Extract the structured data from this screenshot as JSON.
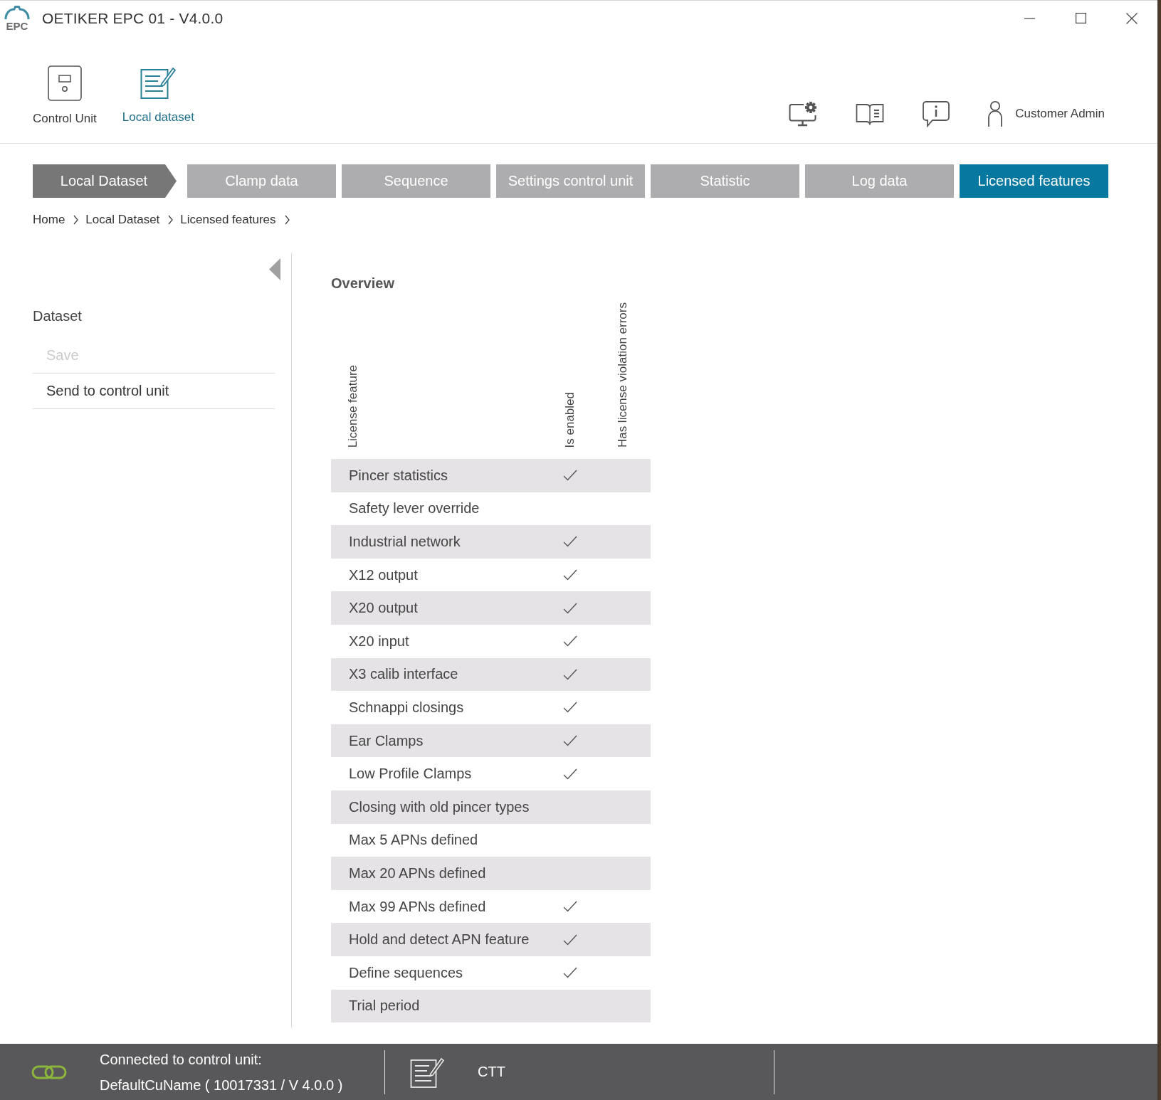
{
  "window": {
    "logo_text": "EPC",
    "title": "OETIKER EPC 01 - V4.0.0"
  },
  "toolbar": {
    "items": [
      {
        "label": "Control Unit",
        "selected": false
      },
      {
        "label": "Local dataset",
        "selected": true
      }
    ],
    "user": "Customer Admin"
  },
  "tabs": [
    {
      "label": "Local Dataset",
      "kind": "parent",
      "selected": false
    },
    {
      "label": "Clamp data",
      "kind": "page",
      "selected": false
    },
    {
      "label": "Sequence",
      "kind": "page",
      "selected": false
    },
    {
      "label": "Settings control unit",
      "kind": "page",
      "selected": false
    },
    {
      "label": "Statistic",
      "kind": "page",
      "selected": false
    },
    {
      "label": "Log data",
      "kind": "page",
      "selected": false
    },
    {
      "label": "Licensed features",
      "kind": "page",
      "selected": true
    }
  ],
  "breadcrumb": [
    "Home",
    "Local Dataset",
    "Licensed features"
  ],
  "sidebar": {
    "title": "Dataset",
    "actions": [
      {
        "label": "Save",
        "disabled": true
      },
      {
        "label": "Send to control unit",
        "disabled": false
      }
    ]
  },
  "overview": {
    "title": "Overview",
    "columns": [
      "License feature",
      "Is enabled",
      "Has license violation errors"
    ],
    "rows": [
      {
        "feature": "Pincer statistics",
        "enabled": true
      },
      {
        "feature": "Safety lever override",
        "enabled": false
      },
      {
        "feature": "Industrial network",
        "enabled": true
      },
      {
        "feature": "X12 output",
        "enabled": true
      },
      {
        "feature": "X20 output",
        "enabled": true
      },
      {
        "feature": "X20 input",
        "enabled": true
      },
      {
        "feature": "X3 calib interface",
        "enabled": true
      },
      {
        "feature": "Schnappi closings",
        "enabled": true
      },
      {
        "feature": "Ear Clamps",
        "enabled": true
      },
      {
        "feature": "Low Profile Clamps",
        "enabled": true
      },
      {
        "feature": "Closing with old pincer types",
        "enabled": false
      },
      {
        "feature": "Max 5 APNs defined",
        "enabled": false
      },
      {
        "feature": "Max 20 APNs defined",
        "enabled": false
      },
      {
        "feature": "Max 99 APNs defined",
        "enabled": true
      },
      {
        "feature": "Hold and detect APN feature",
        "enabled": true
      },
      {
        "feature": "Define sequences",
        "enabled": true
      },
      {
        "feature": "Trial period",
        "enabled": false
      }
    ]
  },
  "status_bar": {
    "connection": [
      "Connected to control unit:",
      "DefaultCuName ( 10017331 / V 4.0.0 )"
    ],
    "dataset": "CTT"
  }
}
